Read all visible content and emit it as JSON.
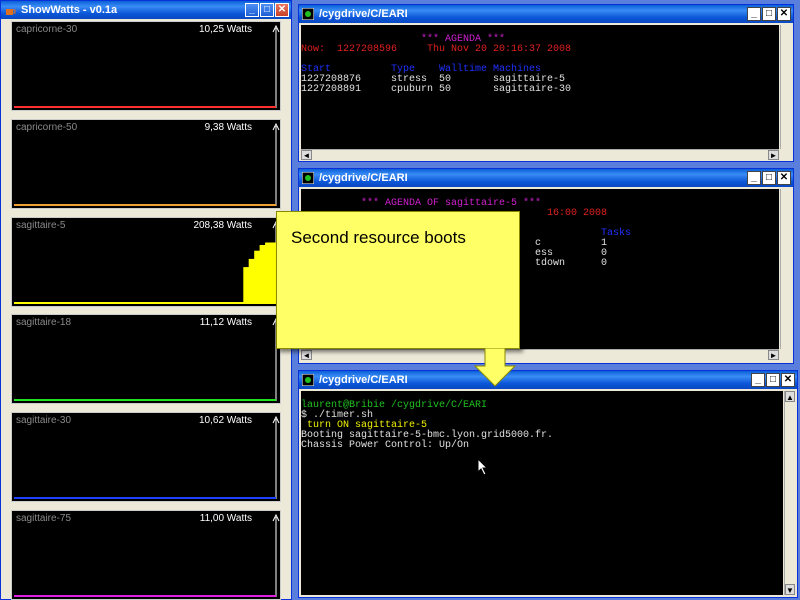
{
  "showwatts": {
    "title": "ShowWatts - v0.1a",
    "panels": [
      {
        "name": "capricorne-30",
        "watts": "10,25 Watts",
        "color": "#ff3030"
      },
      {
        "name": "capricorne-50",
        "watts": "9,38 Watts",
        "color": "#f0a030"
      },
      {
        "name": "sagittaire-5",
        "watts": "208,38 Watts",
        "color": "#ffff00"
      },
      {
        "name": "sagittaire-18",
        "watts": "11,12 Watts",
        "color": "#20e020"
      },
      {
        "name": "sagittaire-30",
        "watts": "10,62 Watts",
        "color": "#2040ff"
      },
      {
        "name": "sagittaire-75",
        "watts": "11,00 Watts",
        "color": "#e020e0"
      }
    ]
  },
  "term1": {
    "title": "/cygdrive/C/EARI",
    "lines": [
      {
        "text": "",
        "cls": "wht"
      },
      {
        "text": "                    *** AGENDA ***",
        "cls": "mag"
      },
      {
        "text": "Now:  1227208596     Thu Nov 20 20:16:37 2008",
        "cls": "red"
      },
      {
        "text": "",
        "cls": "wht"
      },
      {
        "text": "Start          Type    Walltime Machines",
        "cls": "blu"
      },
      {
        "text": "1227208876     stress  50       sagittaire-5",
        "cls": "wht"
      },
      {
        "text": "1227208891     cpuburn 50       sagittaire-30",
        "cls": "wht"
      }
    ]
  },
  "term2": {
    "title": "/cygdrive/C/EARI",
    "lines": [
      {
        "text": "",
        "cls": "wht"
      },
      {
        "text": "          *** AGENDA OF sagittaire-5 ***",
        "cls": "mag"
      },
      {
        "text": "                                         16:00 2008",
        "cls": "red"
      },
      {
        "text": "",
        "cls": "wht"
      },
      {
        "text": "                                                  Tasks",
        "cls": "blu"
      },
      {
        "text": "                                       c          1",
        "cls": "wht"
      },
      {
        "text": "                                       ess        0",
        "cls": "wht"
      },
      {
        "text": "                                       tdown      0",
        "cls": "wht"
      }
    ]
  },
  "term3": {
    "title": "/cygdrive/C/EARI",
    "lines": [
      {
        "text": "",
        "cls": "wht"
      },
      {
        "text": "laurent@Bribie /cygdrive/C/EARI",
        "cls": "grn"
      },
      {
        "text": "$ ./timer.sh",
        "cls": "wht"
      },
      {
        "text": " turn ON sagittaire-5",
        "cls": "yel"
      },
      {
        "text": "Booting sagittaire-5-bmc.lyon.grid5000.fr.",
        "cls": "wht"
      },
      {
        "text": "Chassis Power Control: Up/On",
        "cls": "wht"
      }
    ]
  },
  "callout": {
    "text": "Second resource boots"
  },
  "sag5_levels": [
    0,
    0,
    0,
    0,
    0,
    0,
    0,
    0,
    0,
    0,
    0,
    0,
    0,
    0,
    0,
    0,
    0,
    0,
    0,
    0,
    0,
    0,
    0,
    0,
    0,
    0,
    0,
    0,
    0,
    0,
    0,
    0,
    0,
    0,
    0,
    0,
    0,
    0,
    0,
    0,
    0,
    0,
    0.45,
    0.55,
    0.65,
    0.72,
    0.75,
    0.75
  ]
}
